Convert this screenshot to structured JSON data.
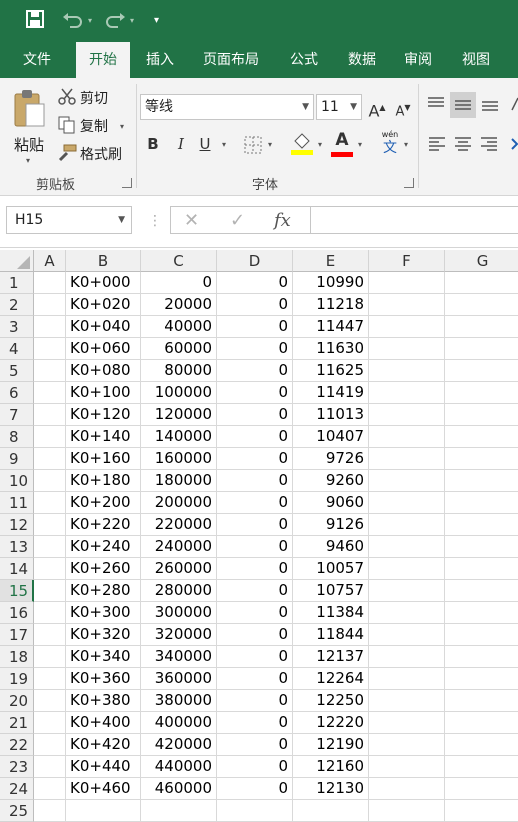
{
  "quick_access": {
    "save_icon": "save-icon",
    "undo_icon": "undo-icon",
    "redo_icon": "redo-icon",
    "customize_icon": "customize-qat-icon"
  },
  "tabs": [
    "文件",
    "开始",
    "插入",
    "页面布局",
    "公式",
    "数据",
    "审阅",
    "视图"
  ],
  "active_tab": "开始",
  "clipboard": {
    "paste_label": "粘贴",
    "cut_label": "剪切",
    "copy_label": "复制",
    "format_painter_label": "格式刷",
    "group_label": "剪贴板"
  },
  "font": {
    "font_name": "等线",
    "font_size": "11",
    "grow_label": "A",
    "shrink_label": "A",
    "bold_label": "B",
    "italic_label": "I",
    "underline_label": "U",
    "font_color_label": "A",
    "phonetic_label": "wén",
    "phonetic_sub": "文",
    "group_label": "字体",
    "fill_color": "#ffff00",
    "font_color": "#ff0000"
  },
  "formula_bar": {
    "name_box": "H15",
    "cancel_symbol": "✕",
    "enter_symbol": "✓",
    "fx_symbol": "fx",
    "value": ""
  },
  "accent_color": "#217346",
  "selected_row": "15",
  "columns": [
    "A",
    "B",
    "C",
    "D",
    "E",
    "F",
    "G"
  ],
  "rows": [
    {
      "n": "1",
      "b": "K0+000",
      "c": "0",
      "d": "0",
      "e": "10990"
    },
    {
      "n": "2",
      "b": "K0+020",
      "c": "20000",
      "d": "0",
      "e": "11218"
    },
    {
      "n": "3",
      "b": "K0+040",
      "c": "40000",
      "d": "0",
      "e": "11447"
    },
    {
      "n": "4",
      "b": "K0+060",
      "c": "60000",
      "d": "0",
      "e": "11630"
    },
    {
      "n": "5",
      "b": "K0+080",
      "c": "80000",
      "d": "0",
      "e": "11625"
    },
    {
      "n": "6",
      "b": "K0+100",
      "c": "100000",
      "d": "0",
      "e": "11419"
    },
    {
      "n": "7",
      "b": "K0+120",
      "c": "120000",
      "d": "0",
      "e": "11013"
    },
    {
      "n": "8",
      "b": "K0+140",
      "c": "140000",
      "d": "0",
      "e": "10407"
    },
    {
      "n": "9",
      "b": "K0+160",
      "c": "160000",
      "d": "0",
      "e": "9726"
    },
    {
      "n": "10",
      "b": "K0+180",
      "c": "180000",
      "d": "0",
      "e": "9260"
    },
    {
      "n": "11",
      "b": "K0+200",
      "c": "200000",
      "d": "0",
      "e": "9060"
    },
    {
      "n": "12",
      "b": "K0+220",
      "c": "220000",
      "d": "0",
      "e": "9126"
    },
    {
      "n": "13",
      "b": "K0+240",
      "c": "240000",
      "d": "0",
      "e": "9460"
    },
    {
      "n": "14",
      "b": "K0+260",
      "c": "260000",
      "d": "0",
      "e": "10057"
    },
    {
      "n": "15",
      "b": "K0+280",
      "c": "280000",
      "d": "0",
      "e": "10757"
    },
    {
      "n": "16",
      "b": "K0+300",
      "c": "300000",
      "d": "0",
      "e": "11384"
    },
    {
      "n": "17",
      "b": "K0+320",
      "c": "320000",
      "d": "0",
      "e": "11844"
    },
    {
      "n": "18",
      "b": "K0+340",
      "c": "340000",
      "d": "0",
      "e": "12137"
    },
    {
      "n": "19",
      "b": "K0+360",
      "c": "360000",
      "d": "0",
      "e": "12264"
    },
    {
      "n": "20",
      "b": "K0+380",
      "c": "380000",
      "d": "0",
      "e": "12250"
    },
    {
      "n": "21",
      "b": "K0+400",
      "c": "400000",
      "d": "0",
      "e": "12220"
    },
    {
      "n": "22",
      "b": "K0+420",
      "c": "420000",
      "d": "0",
      "e": "12190"
    },
    {
      "n": "23",
      "b": "K0+440",
      "c": "440000",
      "d": "0",
      "e": "12160"
    },
    {
      "n": "24",
      "b": "K0+460",
      "c": "460000",
      "d": "0",
      "e": "12130"
    },
    {
      "n": "25",
      "b": "",
      "c": "",
      "d": "",
      "e": ""
    }
  ]
}
